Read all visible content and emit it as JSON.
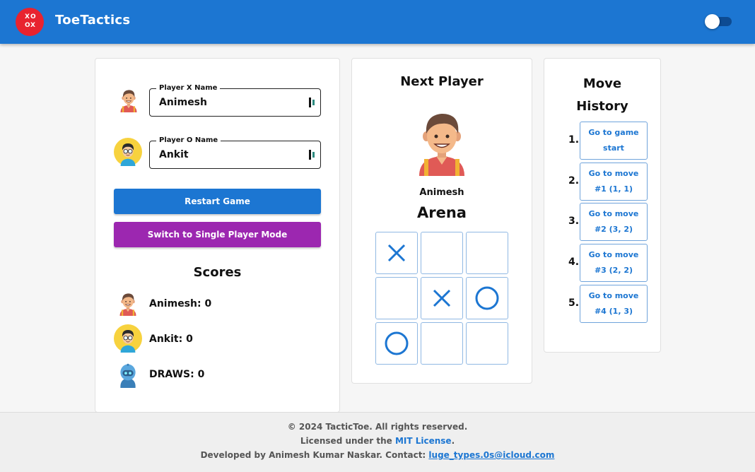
{
  "header": {
    "logo_glyphs": [
      "X",
      "O",
      "O",
      "X"
    ],
    "brand": "ToeTactics",
    "theme_toggle": "off",
    "accent_color": "#1c76d2"
  },
  "players": {
    "x_label": "Player X Name",
    "x_value": "Animesh",
    "o_label": "Player O Name",
    "o_value": "Ankit"
  },
  "buttons": {
    "restart": "Restart Game",
    "switch_mode": "Switch to Single Player Mode"
  },
  "scores": {
    "title": "Scores",
    "animesh": "Animesh: 0",
    "ankit": "Ankit: 0",
    "draws": "DRAWS: 0"
  },
  "game": {
    "next_title": "Next Player",
    "next_name": "Animesh",
    "arena_title": "Arena",
    "board": [
      "X",
      "",
      "",
      "",
      "X",
      "O",
      "O",
      "",
      ""
    ]
  },
  "history": {
    "title": "Move History",
    "items": [
      {
        "num": "1.",
        "label": "Go to game start"
      },
      {
        "num": "2.",
        "label": "Go to move #1 (1, 1)"
      },
      {
        "num": "3.",
        "label": "Go to move #2 (3, 2)"
      },
      {
        "num": "4.",
        "label": "Go to move #3 (2, 2)"
      },
      {
        "num": "5.",
        "label": "Go to move #4 (1, 3)"
      }
    ]
  },
  "footer": {
    "copyright": "© 2024 TacticToe. All rights reserved.",
    "license_prefix": "Licensed under the ",
    "license_link": "MIT License",
    "license_suffix": ".",
    "dev_prefix": "Developed by Animesh Kumar Naskar. Contact: ",
    "dev_email": "luge_types.0s@icloud.com"
  }
}
